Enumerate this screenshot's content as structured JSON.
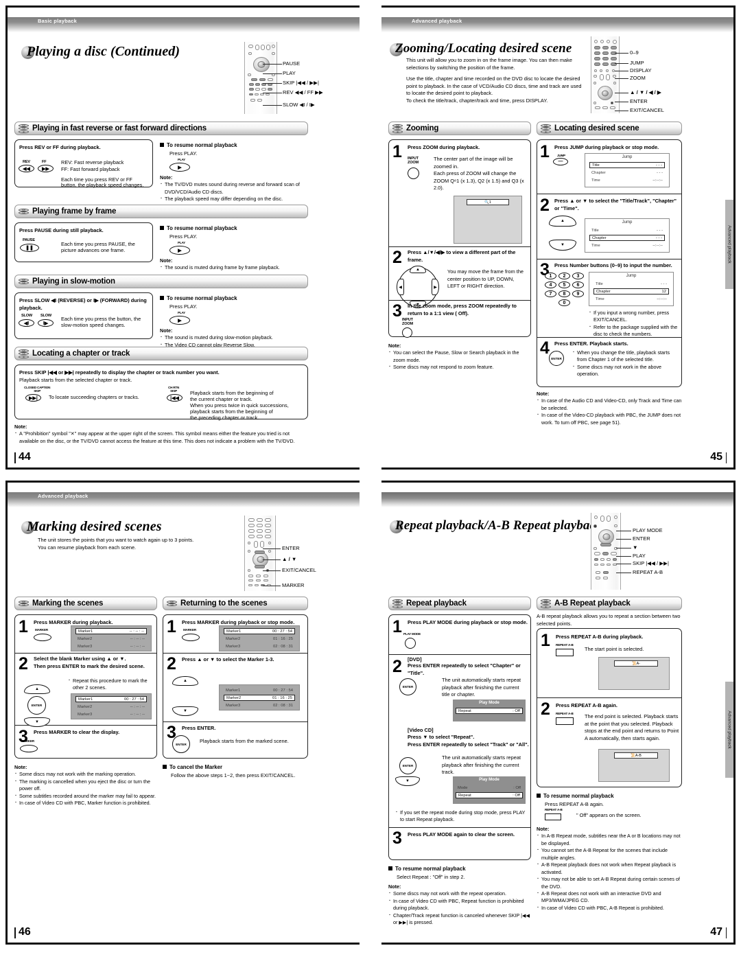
{
  "document": {
    "type": "dvd-player-user-manual-spread"
  },
  "pages": [
    {
      "folio": "44",
      "running_head": "Basic playback",
      "title": "Playing a disc (Continued)",
      "remote_callouts": [
        "PAUSE",
        "PLAY",
        "SKIP |◀◀ / ▶▶|",
        "REV ◀◀ / FF ▶▶",
        "SLOW ◀I / I▶"
      ],
      "sections": [
        {
          "heading": "Playing in fast reverse or fast forward directions",
          "disc_types": [
            "DVD",
            "VCD",
            "CD"
          ],
          "instruction": "Press REV or FF during playback.",
          "button_caps": [
            "REV",
            "FF"
          ],
          "body_lines": [
            "REV:  Fast reverse playback",
            "FF:    Fast forward playback",
            "Each time you press REV or FF",
            "button, the playback speed changes."
          ],
          "resume_heading": "To resume normal playback",
          "resume_text": "Press PLAY.",
          "resume_button": "PLAY",
          "note_heading": "Note:",
          "notes": [
            "The TV/DVD mutes sound during reverse and forward scan of DVD/VCD/Audio CD discs.",
            "The playback speed may differ depending on the disc."
          ]
        },
        {
          "heading": "Playing frame by frame",
          "disc_types": [
            "DVD",
            "VCD"
          ],
          "instruction": "Press PAUSE during still playback.",
          "button_caps": [
            "PAUSE"
          ],
          "body_lines": [
            "Each time you press PAUSE, the",
            "picture advances one frame."
          ],
          "resume_heading": "To resume normal playback",
          "resume_text": "Press PLAY.",
          "resume_button": "PLAY",
          "note_heading": "Note:",
          "notes": [
            "The sound is muted during frame by frame playback."
          ]
        },
        {
          "heading": "Playing in slow-motion",
          "disc_types": [
            "DVD",
            "VCD"
          ],
          "instruction": "Press SLOW ◀I (REVERSE) or I▶ (FORWARD) during playback.",
          "button_caps": [
            "SLOW",
            "SLOW"
          ],
          "body_lines": [
            "Each time you press the button, the",
            "slow-motion speed changes."
          ],
          "resume_heading": "To resume normal playback",
          "resume_text": "Press PLAY.",
          "resume_button": "PLAY",
          "note_heading": "Note:",
          "notes": [
            "The sound is muted during slow-motion playback.",
            "The Video CD cannot play Reverse Slow."
          ]
        },
        {
          "heading": "Locating a chapter or track",
          "disc_types": [
            "DVD",
            "VCD",
            "CD"
          ],
          "instruction": "Press SKIP |◀◀ or ▶▶| repeatedly to display the chapter or track number you want.",
          "subtext": "Playback starts from the selected chapter or track.",
          "left_caption": "CLOSED CAPTION\nSKIP",
          "left_text": "To locate succeeding chapters or tracks.",
          "right_caption": "CH RTN\nSKIP",
          "right_lines": [
            "Playback starts from the beginning of",
            "the current chapter or track.",
            "When you press twice in quick successions,",
            "playback starts from the beginning of",
            "the preceding chapter or track."
          ]
        }
      ],
      "page_note_heading": "Note:",
      "page_notes": [
        "A \"Prohibition\" symbol \"✕\" may appear at the upper right of the screen. This symbol means either the feature you tried is not available on the disc, or the TV/DVD cannot access the feature at this time. This does not indicate a problem with the TV/DVD."
      ]
    },
    {
      "folio": "45",
      "running_head": "Advanced playback",
      "title": "Zooming/Locating desired scene",
      "intro_paragraph_1": "This unit will allow you to zoom in on the frame image. You can then make selections by switching the position of the frame.",
      "intro_paragraph_2": "Use the title, chapter and time recorded on the DVD disc to locate the desired point to playback. In the case of VCD/Audio CD discs, time and track are used to locate the desired point to playback.\nTo check the title/track, chapter/track and time, press DISPLAY.",
      "remote_callouts": [
        "0–9",
        "JUMP",
        "DISPLAY",
        "ZOOM",
        "▲ / ▼ / ◀ / ▶",
        "ENTER",
        "EXIT/CANCEL"
      ],
      "thumb_tab": "Advanced playback",
      "left_section": {
        "heading": "Zooming",
        "disc_types": [
          "DVD",
          "VCD",
          "CD"
        ],
        "steps": [
          {
            "num": "1",
            "instruction": "Press ZOOM during playback.",
            "button_caption": "INPUT\nZOOM",
            "body": "The center part of the image will be zoomed in.\nEach press of ZOOM will change the ZOOM Q⁸1 (x 1.3), Q2 (x 1.5) and Q3 (x 2.0).",
            "osd_chip": "1"
          },
          {
            "num": "2",
            "instruction": "Press ▲/▼/◀/▶ to view a different part of the frame.",
            "body": "You may move the frame from the center position to UP, DOWN, LEFT or RIGHT direction."
          },
          {
            "num": "3",
            "instruction": "In the zoom mode, press ZOOM repeatedly to return to a 1:1 view ( Off).",
            "button_caption": "INPUT\nZOOM"
          }
        ],
        "note_heading": "Note:",
        "notes": [
          "You can select the Pause, Slow or Search playback in the zoom mode.",
          "Some discs may not respond to zoom feature."
        ]
      },
      "right_section": {
        "heading": "Locating desired scene",
        "disc_types": [
          "DVD",
          "VCD",
          "CD"
        ],
        "steps": [
          {
            "num": "1",
            "instruction": "Press JUMP during playback or stop mode.",
            "button_caption": "JUMP",
            "osd": {
              "title": "Jump",
              "rows": [
                {
                  "label": "Title",
                  "value": "- - -",
                  "selected": true
                },
                {
                  "label": "Chapter",
                  "value": "- - -",
                  "selected": false
                },
                {
                  "label": "Time",
                  "value": "--:--:--",
                  "selected": false
                }
              ]
            }
          },
          {
            "num": "2",
            "instruction": "Press ▲ or ▼ to select the \"Title/Track\", \"Chapter\" or \"Time\".",
            "osd": {
              "title": "Jump",
              "rows": [
                {
                  "label": "Title",
                  "value": "- - -",
                  "selected": false
                },
                {
                  "label": "Chapter",
                  "value": "- - -",
                  "selected": true
                },
                {
                  "label": "Time",
                  "value": "--:--:--",
                  "selected": false
                }
              ]
            }
          },
          {
            "num": "3",
            "instruction": "Press Number buttons (0–9) to input the number.",
            "number_buttons": [
              "1",
              "2",
              "3",
              "4",
              "5",
              "6",
              "7",
              "8",
              "9",
              "0"
            ],
            "osd": {
              "title": "Jump",
              "rows": [
                {
                  "label": "Title",
                  "value": "- - -",
                  "selected": false
                },
                {
                  "label": "Chapter",
                  "value": "12",
                  "selected": true
                },
                {
                  "label": "Time",
                  "value": "--:--:--",
                  "selected": false
                }
              ]
            },
            "bullets": [
              "If you input a wrong number, press EXIT/CANCEL.",
              "Refer to the package supplied with the disc to check the numbers."
            ]
          },
          {
            "num": "4",
            "instruction": "Press ENTER. Playback starts.",
            "button_caption": "ENTER",
            "bullets": [
              "When you change the title, playback starts from Chapter 1 of the selected title.",
              "Some discs may not work in the above operation."
            ]
          }
        ],
        "note_heading": "Note:",
        "notes": [
          "In case of the Audio CD and Video-CD, only Track and Time can be selected.",
          "In case of the Video-CD playback with PBC, the JUMP does not work. To turn off PBC, see page 51)."
        ],
        "note_page_ref": "51"
      }
    },
    {
      "folio": "46",
      "running_head": "Advanced playback",
      "title": "Marking desired scenes",
      "intro_paragraph": "The unit stores the points that you want to watch again up to 3 points.\nYou can resume playback from each scene.",
      "remote_callouts": [
        "ENTER",
        "▲ / ▼",
        "EXIT/CANCEL",
        "MARKER"
      ],
      "left_section": {
        "heading": "Marking the scenes",
        "disc_types": [
          "DVD",
          "VCD"
        ],
        "steps": [
          {
            "num": "1",
            "instruction": "Press MARKER during playback.",
            "button_caption": "MARKER",
            "osd": {
              "rows": [
                {
                  "label": "Marker1",
                  "value": "-- : -- : --",
                  "selected": true
                },
                {
                  "label": "Marker2",
                  "value": "-- : -- : --",
                  "selected": false
                },
                {
                  "label": "Marker3",
                  "value": "-- : -- : --",
                  "selected": false
                }
              ]
            }
          },
          {
            "num": "2",
            "instruction": "Select the blank Marker using ▲ or ▼.\nThen press ENTER to mark the desired scene.",
            "bullets": [
              "Repeat this procedure to mark the other 2 scenes."
            ],
            "osd": {
              "rows": [
                {
                  "label": "Marker1",
                  "value": "00 : 27 : 54",
                  "selected": true
                },
                {
                  "label": "Marker2",
                  "value": "-- : -- : --",
                  "selected": false
                },
                {
                  "label": "Marker3",
                  "value": "-- : -- : --",
                  "selected": false
                }
              ]
            }
          },
          {
            "num": "3",
            "instruction": "Press MARKER to clear the display.",
            "button_caption": "MARKER"
          }
        ],
        "note_heading": "Note:",
        "notes": [
          "Some discs may not work with the marking operation.",
          "The marking is cancelled when you eject the disc or turn the power off.",
          "Some subtitles recorded around the marker may fail to appear.",
          "In case of Video CD with PBC, Marker function is prohibited."
        ]
      },
      "right_section": {
        "heading": "Returning to the scenes",
        "disc_types": [
          "DVD",
          "VCD"
        ],
        "steps": [
          {
            "num": "1",
            "instruction": "Press MARKER during playback or stop mode.",
            "button_caption": "MARKER",
            "osd": {
              "rows": [
                {
                  "label": "Marker1",
                  "value": "00 : 27 : 54",
                  "selected": true
                },
                {
                  "label": "Marker2",
                  "value": "01 : 16 : 25",
                  "selected": false
                },
                {
                  "label": "Marker3",
                  "value": "02 : 08 : 31",
                  "selected": false
                }
              ]
            }
          },
          {
            "num": "2",
            "instruction": "Press ▲ or ▼ to select the Marker 1-3.",
            "osd": {
              "rows": [
                {
                  "label": "Marker1",
                  "value": "00 : 27 : 54",
                  "selected": false
                },
                {
                  "label": "Marker2",
                  "value": "01 : 16 : 25",
                  "selected": true
                },
                {
                  "label": "Marker3",
                  "value": "02 : 08 : 31",
                  "selected": false
                }
              ]
            }
          },
          {
            "num": "3",
            "instruction": "Press ENTER.",
            "button_caption": "ENTER",
            "body": "Playback starts from the marked scene."
          }
        ],
        "cancel_heading": "To cancel the Marker",
        "cancel_text": "Follow the above steps 1~2, then press EXIT/CANCEL."
      }
    },
    {
      "folio": "47",
      "running_head": "",
      "title": "Repeat playback/A-B Repeat playback",
      "remote_callouts": [
        "PLAY MODE",
        "ENTER",
        "▼",
        "PLAY",
        "SKIP |◀◀ / ▶▶|",
        "REPEAT A-B"
      ],
      "thumb_tab": "Advanced playback",
      "left_section": {
        "heading": "Repeat playback",
        "disc_types": [
          "DVD",
          "VCD",
          "CD"
        ],
        "steps": [
          {
            "num": "1",
            "instruction": "Press PLAY MODE during playback or stop mode.",
            "button_caption": "PLAY MODE"
          },
          {
            "num": "2",
            "label_dvd": "[DVD]",
            "instruction": "Press ENTER repeatedly to select \"Chapter\" or \"Title\".",
            "button_caption": "ENTER",
            "body": "The unit automatically starts repeat playback after finishing the current title or chapter.",
            "osd": {
              "title": "Play Mode",
              "rows": [
                {
                  "label": "Repeat",
                  "value": ": Off",
                  "selected": true
                }
              ]
            },
            "label_vcd": "[Video CD]",
            "instruction2": "Press ▼ to select \"Repeat\".\nPress ENTER repeatedly to select \"Track\" or \"All\".",
            "body2": "The unit automatically starts repeat playback after finishing the current track.",
            "osd2": {
              "title": "Play Mode",
              "rows": [
                {
                  "label": "Mode",
                  "value": ": Off",
                  "selected": false
                },
                {
                  "label": "Repeat",
                  "value": ": Off",
                  "selected": true
                }
              ]
            },
            "bullets": [
              "If you set the repeat mode during stop mode, press PLAY to start Repeat playback."
            ]
          },
          {
            "num": "3",
            "instruction": "Press PLAY MODE again to clear the screen."
          }
        ],
        "resume_heading": "To resume normal playback",
        "resume_text": "Select Repeat : \"Off\" in step 2.",
        "note_heading": "Note:",
        "notes": [
          "Some discs may not work with the repeat operation.",
          "In case of Video CD with PBC, Repeat function is prohibited during playback.",
          "Chapter/Track repeat function is canceled whenever SKIP |◀◀ or ▶▶| is pressed."
        ]
      },
      "right_section": {
        "heading": "A-B Repeat playback",
        "disc_types": [
          "DVD",
          "VCD",
          "CD"
        ],
        "intro": "A-B repeat playback allows you to repeat a section between two selected points.",
        "steps": [
          {
            "num": "1",
            "instruction": "Press REPEAT A-B during playback.",
            "button_caption": "REPEAT A-B",
            "body": "The start point is selected.",
            "osd_chip": "A-"
          },
          {
            "num": "2",
            "instruction": "Press REPEAT A-B again.",
            "button_caption": "REPEAT A-B",
            "body": "The end point is selected. Playback starts at the point that you selected. Playback stops at the end point and returns to Point A automatically, then starts again.",
            "osd_chip": "A-B"
          }
        ],
        "resume_heading": "To resume normal playback",
        "resume_text": "Press REPEAT A-B again.",
        "resume_button": "REPEAT A-B",
        "resume_note": "\" Off\" appears on the screen.",
        "note_heading": "Note:",
        "notes": [
          "In A-B Repeat mode, subtitles near the A or B locations may not be displayed.",
          "You cannot set the A-B Repeat for the scenes that include multiple angles.",
          "A-B Repeat playback does not work when Repeat playback is activated.",
          "You may not be able to set A-B Repeat during certain scenes of the DVD.",
          "A-B Repeat does not work with an interactive DVD and MP3/WMA/JPEG CD.",
          "In case of Video CD with PBC, A-B Repeat is prohibited."
        ]
      }
    }
  ]
}
